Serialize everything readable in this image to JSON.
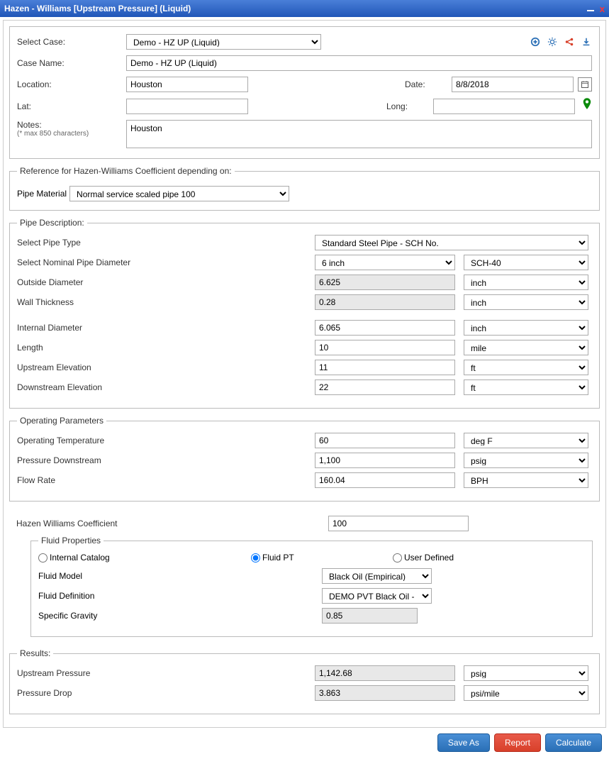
{
  "title": "Hazen - Williams [Upstream Pressure] (Liquid)",
  "header": {
    "selectCaseLabel": "Select Case:",
    "selectCaseValue": "Demo - HZ UP (Liquid)",
    "caseNameLabel": "Case Name:",
    "caseNameValue": "Demo - HZ UP (Liquid)",
    "locationLabel": "Location:",
    "locationValue": "Houston",
    "dateLabel": "Date:",
    "dateValue": "8/8/2018",
    "latLabel": "Lat:",
    "latValue": "",
    "longLabel": "Long:",
    "longValue": "",
    "notesLabel": "Notes:",
    "notesSub": "(* max 850 characters)",
    "notesValue": "Houston"
  },
  "reference": {
    "legend": "Reference for Hazen-Williams Coefficient depending on:",
    "pipeMaterialLabel": "Pipe Material",
    "pipeMaterialValue": "Normal service scaled pipe 100"
  },
  "pipeDesc": {
    "legend": "Pipe Description:",
    "rows": [
      {
        "label": "Select Pipe Type",
        "value": "Standard Steel Pipe - SCH No.",
        "unit": "",
        "valueType": "select-full"
      },
      {
        "label": "Select Nominal Pipe Diameter",
        "value": "6 inch",
        "unit": "SCH-40",
        "valueType": "select"
      },
      {
        "label": "Outside Diameter",
        "value": "6.625",
        "unit": "inch",
        "valueType": "ro"
      },
      {
        "label": "Wall Thickness",
        "value": "0.28",
        "unit": "inch",
        "valueType": "ro"
      },
      {
        "label": "Internal Diameter",
        "value": "6.065",
        "unit": "inch",
        "valueType": "input"
      },
      {
        "label": "Length",
        "value": "10",
        "unit": "mile",
        "valueType": "input"
      },
      {
        "label": "Upstream Elevation",
        "value": "11",
        "unit": "ft",
        "valueType": "input"
      },
      {
        "label": "Downstream Elevation",
        "value": "22",
        "unit": "ft",
        "valueType": "input"
      }
    ]
  },
  "operating": {
    "legend": "Operating Parameters",
    "rows": [
      {
        "label": "Operating Temperature",
        "value": "60",
        "unit": "deg F"
      },
      {
        "label": "Pressure Downstream",
        "value": "1,100",
        "unit": "psig"
      },
      {
        "label": "Flow Rate",
        "value": "160.04",
        "unit": "BPH"
      }
    ]
  },
  "hazen": {
    "label": "Hazen Williams Coefficient",
    "value": "100"
  },
  "fluidProps": {
    "legend": "Fluid Properties",
    "radios": {
      "internal": "Internal Catalog",
      "fluidpt": "Fluid PT",
      "userdef": "User Defined"
    },
    "fluidModelLabel": "Fluid Model",
    "fluidModelValue": "Black Oil (Empirical)",
    "fluidDefLabel": "Fluid Definition",
    "fluidDefValue": "DEMO PVT Black Oil - DEMO",
    "specificGravityLabel": "Specific Gravity",
    "specificGravityValue": "0.85"
  },
  "results": {
    "legend": "Results:",
    "rows": [
      {
        "label": "Upstream Pressure",
        "value": "1,142.68",
        "unit": "psig"
      },
      {
        "label": "Pressure Drop",
        "value": "3.863",
        "unit": "psi/mile"
      }
    ]
  },
  "buttons": {
    "saveAs": "Save As",
    "report": "Report",
    "calculate": "Calculate"
  }
}
